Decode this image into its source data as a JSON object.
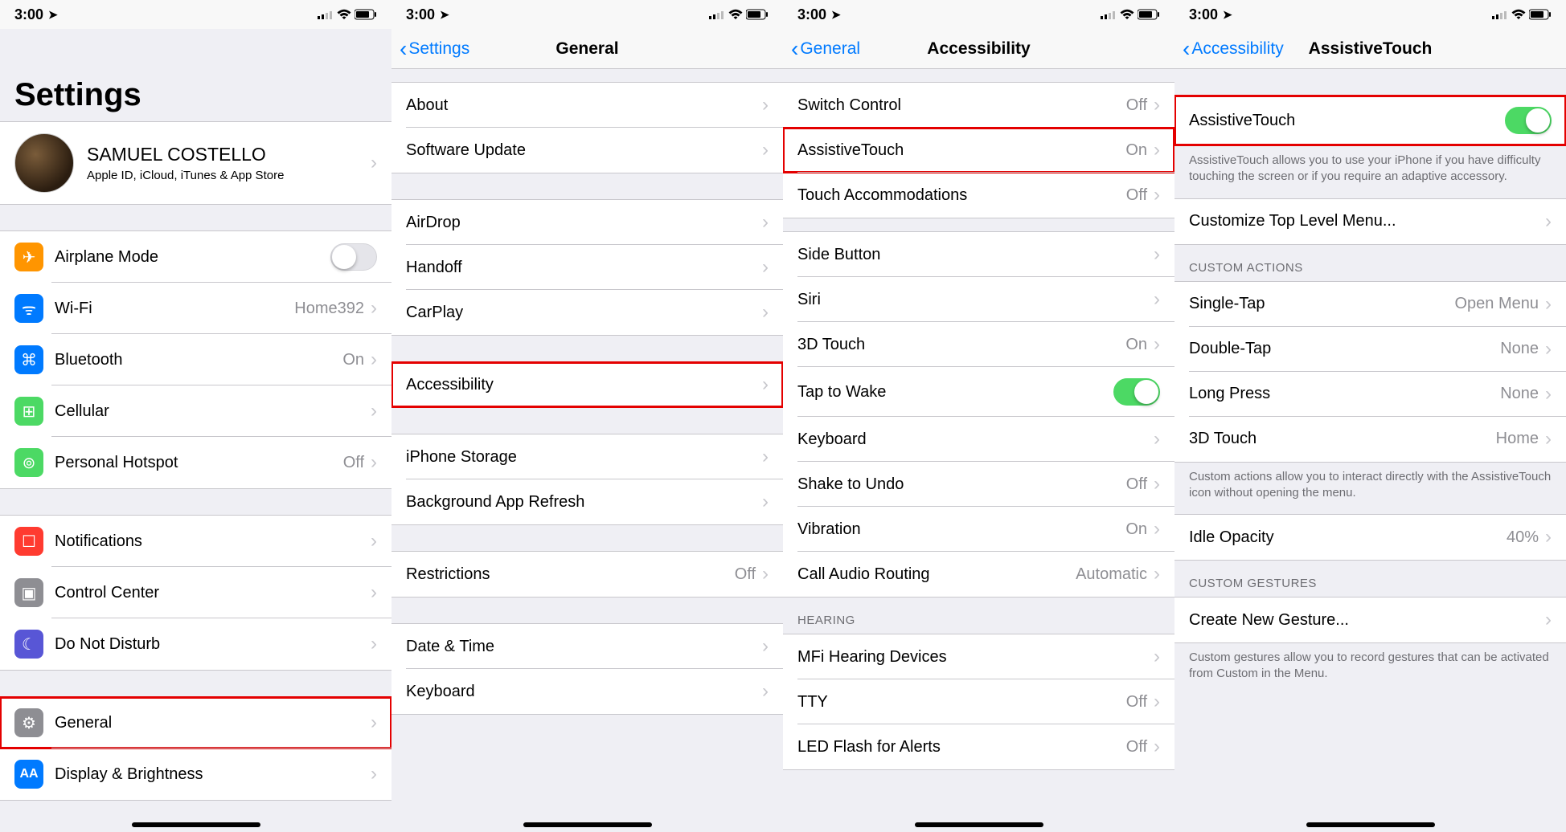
{
  "status": {
    "time": "3:00",
    "signal": 2,
    "wifi": 3
  },
  "p1": {
    "title": "Settings",
    "profile": {
      "name": "SAMUEL COSTELLO",
      "sub": "Apple ID, iCloud, iTunes & App Store"
    },
    "group1": [
      {
        "label": "Airplane Mode",
        "toggle": false,
        "icon": "airplane"
      },
      {
        "label": "Wi-Fi",
        "value": "Home392",
        "icon": "wifi"
      },
      {
        "label": "Bluetooth",
        "value": "On",
        "icon": "bluetooth"
      },
      {
        "label": "Cellular",
        "icon": "cellular"
      },
      {
        "label": "Personal Hotspot",
        "value": "Off",
        "icon": "hotspot"
      }
    ],
    "group2": [
      {
        "label": "Notifications",
        "icon": "notifications"
      },
      {
        "label": "Control Center",
        "icon": "controlcenter"
      },
      {
        "label": "Do Not Disturb",
        "icon": "dnd"
      }
    ],
    "group3": [
      {
        "label": "General",
        "icon": "general",
        "highlight": true
      },
      {
        "label": "Display & Brightness",
        "icon": "display"
      }
    ]
  },
  "p2": {
    "back": "Settings",
    "title": "General",
    "g1": [
      {
        "label": "About"
      },
      {
        "label": "Software Update"
      }
    ],
    "g2": [
      {
        "label": "AirDrop"
      },
      {
        "label": "Handoff"
      },
      {
        "label": "CarPlay"
      }
    ],
    "g3": [
      {
        "label": "Accessibility",
        "highlight": true
      }
    ],
    "g4": [
      {
        "label": "iPhone Storage"
      },
      {
        "label": "Background App Refresh"
      }
    ],
    "g5": [
      {
        "label": "Restrictions",
        "value": "Off"
      }
    ],
    "g6": [
      {
        "label": "Date & Time"
      },
      {
        "label": "Keyboard"
      }
    ]
  },
  "p3": {
    "back": "General",
    "title": "Accessibility",
    "g1": [
      {
        "label": "Switch Control",
        "value": "Off"
      },
      {
        "label": "AssistiveTouch",
        "value": "On",
        "highlight": true
      },
      {
        "label": "Touch Accommodations",
        "value": "Off"
      }
    ],
    "g2": [
      {
        "label": "Side Button"
      },
      {
        "label": "Siri"
      },
      {
        "label": "3D Touch",
        "value": "On"
      },
      {
        "label": "Tap to Wake",
        "toggle": true
      },
      {
        "label": "Keyboard"
      },
      {
        "label": "Shake to Undo",
        "value": "Off"
      },
      {
        "label": "Vibration",
        "value": "On"
      },
      {
        "label": "Call Audio Routing",
        "value": "Automatic"
      }
    ],
    "header3": "HEARING",
    "g3": [
      {
        "label": "MFi Hearing Devices"
      },
      {
        "label": "TTY",
        "value": "Off"
      },
      {
        "label": "LED Flash for Alerts",
        "value": "Off"
      }
    ]
  },
  "p4": {
    "back": "Accessibility",
    "title": "AssistiveTouch",
    "g1": [
      {
        "label": "AssistiveTouch",
        "toggle": true,
        "highlight": true
      }
    ],
    "footer1": "AssistiveTouch allows you to use your iPhone if you have difficulty touching the screen or if you require an adaptive accessory.",
    "g2": [
      {
        "label": "Customize Top Level Menu..."
      }
    ],
    "header3": "CUSTOM ACTIONS",
    "g3": [
      {
        "label": "Single-Tap",
        "value": "Open Menu"
      },
      {
        "label": "Double-Tap",
        "value": "None"
      },
      {
        "label": "Long Press",
        "value": "None"
      },
      {
        "label": "3D Touch",
        "value": "Home"
      }
    ],
    "footer3": "Custom actions allow you to interact directly with the AssistiveTouch icon without opening the menu.",
    "g4": [
      {
        "label": "Idle Opacity",
        "value": "40%"
      }
    ],
    "header5": "CUSTOM GESTURES",
    "g5": [
      {
        "label": "Create New Gesture..."
      }
    ],
    "footer5": "Custom gestures allow you to record gestures that can be activated from Custom in the Menu."
  }
}
